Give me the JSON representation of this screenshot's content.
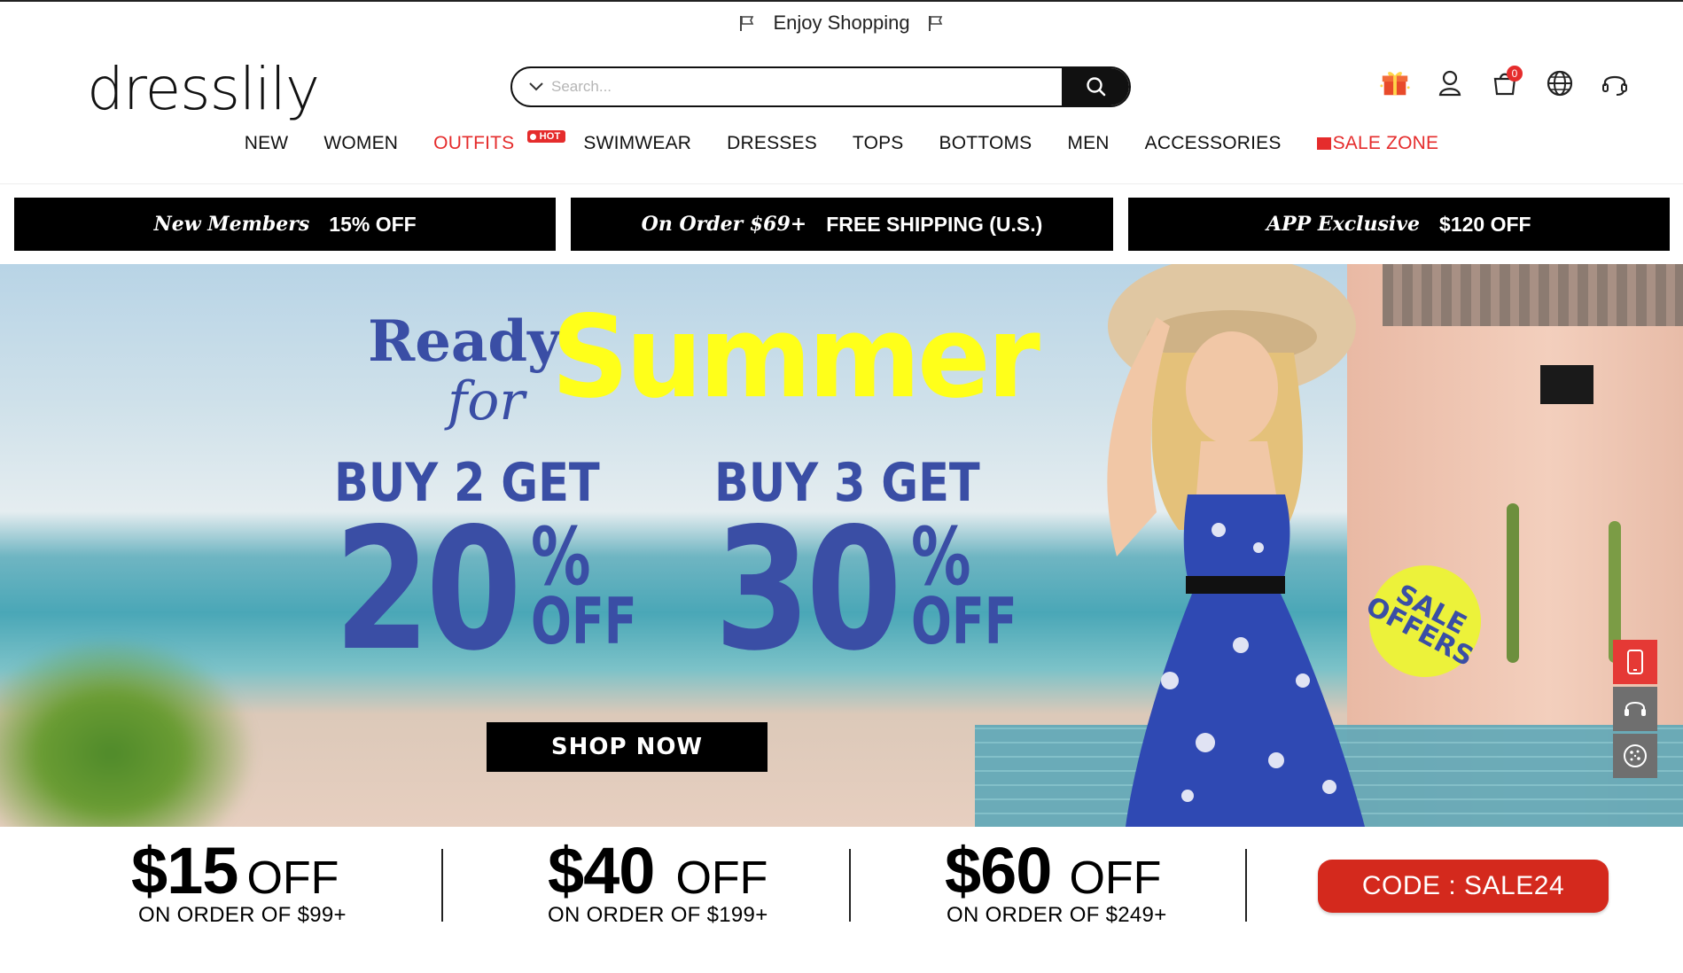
{
  "announcement": {
    "text": "Enjoy Shopping"
  },
  "header": {
    "logo": "dresslily",
    "search": {
      "placeholder": "Search..."
    },
    "cart_count": "0"
  },
  "nav": {
    "items": [
      "NEW",
      "WOMEN",
      "OUTFITS",
      "SWIMWEAR",
      "DRESSES",
      "TOPS",
      "BOTTOMS",
      "MEN",
      "ACCESSORIES",
      "SALE ZONE"
    ],
    "hot_tag": "HOT"
  },
  "promos": [
    {
      "italic": "New Members",
      "bold": "15% OFF"
    },
    {
      "italic": "On Order $69+",
      "bold": "FREE SHIPPING (U.S.)"
    },
    {
      "italic": "APP Exclusive",
      "bold": "$120 OFF"
    }
  ],
  "hero": {
    "ready": "Ready",
    "for": "for",
    "summer": "Summer",
    "deal1": {
      "buy": "BUY 2 GET",
      "pct": "20",
      "sign": "%",
      "off": "OFF"
    },
    "deal2": {
      "buy": "BUY 3 GET",
      "pct": "30",
      "sign": "%",
      "off": "OFF"
    },
    "cta": "SHOP NOW",
    "badge_line1": "SALE",
    "badge_line2": "OFFERS"
  },
  "coupons": [
    {
      "amount": "$15",
      "off": "OFF",
      "sub": "ON ORDER OF $99+"
    },
    {
      "amount": "$40",
      "off": "OFF",
      "sub": "ON ORDER OF $199+"
    },
    {
      "amount": "$60",
      "off": "OFF",
      "sub": "ON ORDER OF $249+"
    }
  ],
  "code": "CODE : SALE24",
  "colors": {
    "brand_blue": "#3a4ea5",
    "summer_yellow": "#ffff1a",
    "accent_red": "#e52c2c",
    "code_red": "#d4291d"
  }
}
